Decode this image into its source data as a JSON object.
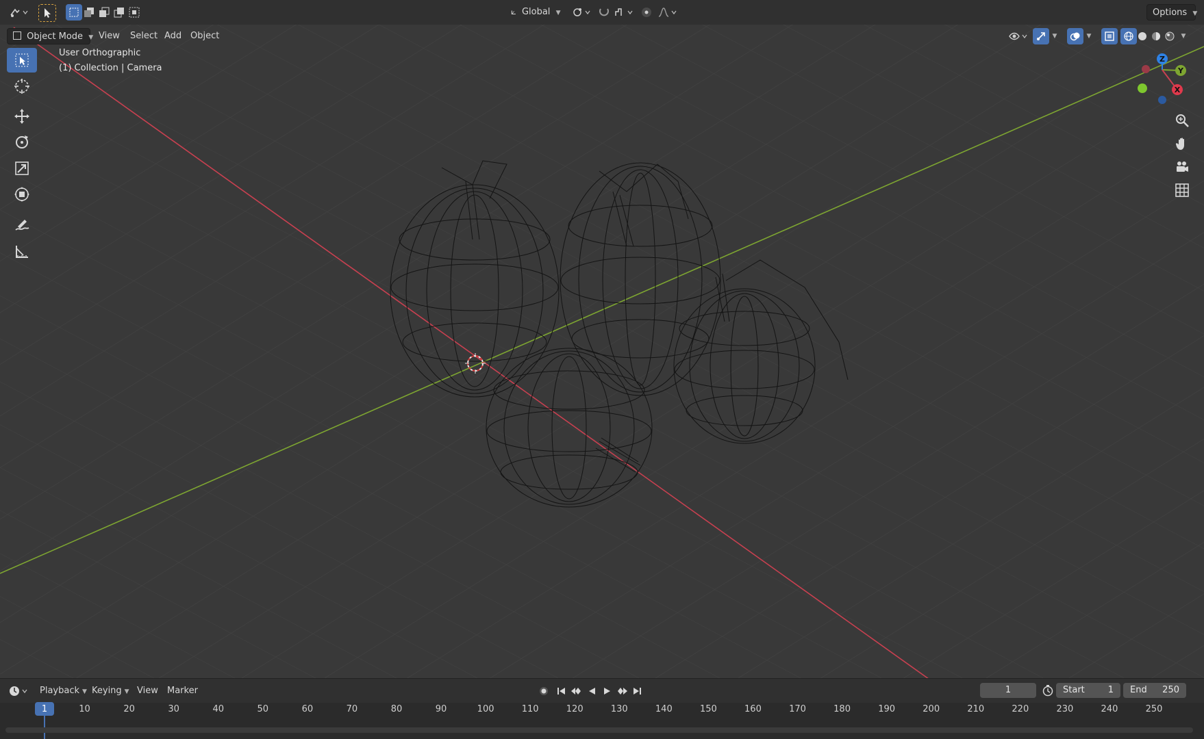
{
  "topbar": {
    "orientation_label": "Global",
    "options_label": "Options"
  },
  "header": {
    "mode_label": "Object Mode",
    "menu": [
      "View",
      "Select",
      "Add",
      "Object"
    ]
  },
  "viewport": {
    "view_name": "User Orthographic",
    "collection_info": "(1) Collection | Camera"
  },
  "gizmo": {
    "z_label": "Z",
    "y_label": "Y",
    "x_label": "X"
  },
  "timeline": {
    "menu": [
      "Playback",
      "Keying",
      "View",
      "Marker"
    ],
    "current_frame": "1",
    "start_label": "Start",
    "start_value": "1",
    "end_label": "End",
    "end_value": "250",
    "ticks": [
      "1",
      "10",
      "20",
      "30",
      "40",
      "50",
      "60",
      "70",
      "80",
      "90",
      "100",
      "110",
      "120",
      "130",
      "140",
      "150",
      "160",
      "170",
      "180",
      "190",
      "200",
      "210",
      "220",
      "230",
      "240",
      "250"
    ]
  },
  "colors": {
    "x_axis": "#c94050",
    "y_axis": "#7ea631",
    "accent": "#4772b3"
  }
}
